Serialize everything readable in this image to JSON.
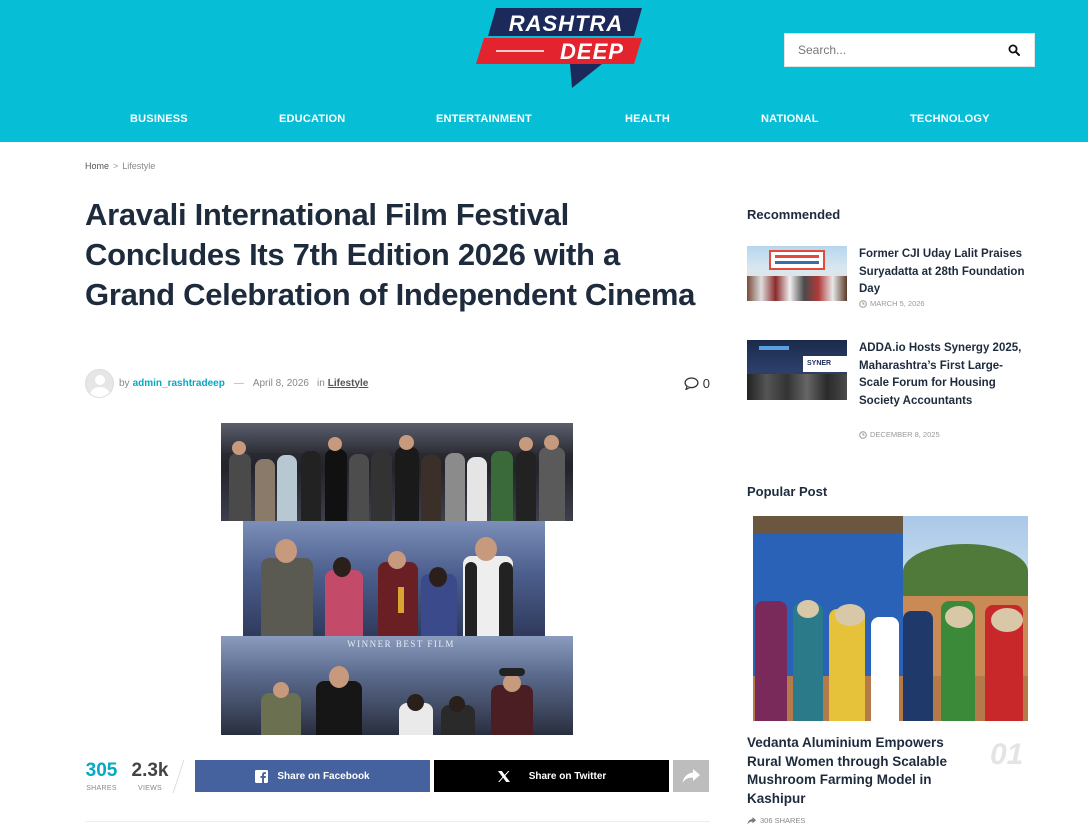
{
  "site": {
    "logo_line1": "RASHTRA",
    "logo_line2": "DEEP"
  },
  "search": {
    "placeholder": "Search..."
  },
  "nav": [
    "BUSINESS",
    "EDUCATION",
    "ENTERTAINMENT",
    "HEALTH",
    "NATIONAL",
    "TECHNOLOGY"
  ],
  "breadcrumb": {
    "home": "Home",
    "sep": ">",
    "current": "Lifestyle"
  },
  "article": {
    "title": "Aravali International Film Festival Concludes Its 7th Edition 2026 with a Grand Celebration of Independent Cinema",
    "by": "by",
    "author": "admin_rashtradeep",
    "dash": "—",
    "date": "April 8, 2026",
    "in": "in",
    "category": "Lifestyle",
    "comments": "0",
    "image_caption_1": "WINNER BEST FILM"
  },
  "share": {
    "shares_count": "305",
    "shares_label": "SHARES",
    "views_count": "2.3k",
    "views_label": "VIEWS",
    "facebook": "Share on Facebook",
    "twitter": "Share on Twitter"
  },
  "sidebar": {
    "recommended_heading": "Recommended",
    "recommended": [
      {
        "title": "Former CJI Uday Lalit Praises Suryadatta at 28th Foundation Day",
        "date": "MARCH 5, 2026"
      },
      {
        "title": "ADDA.io Hosts Synergy 2025, Maharashtra’s First Large-Scale Forum for Housing Society Accountants",
        "date": "DECEMBER 8, 2025"
      }
    ],
    "popular_heading": "Popular Post",
    "popular": {
      "title": "Vedanta Aluminium Empowers Rural Women through Scalable Mushroom Farming Model in Kashipur",
      "number": "01",
      "shares": "306 SHARES"
    }
  },
  "colors": {
    "header_bg": "#06bfd6",
    "accent": "#06a8c4",
    "facebook": "#45629f",
    "twitter": "#000000",
    "logo_red": "#e3232d",
    "logo_navy": "#1b2a5a"
  }
}
